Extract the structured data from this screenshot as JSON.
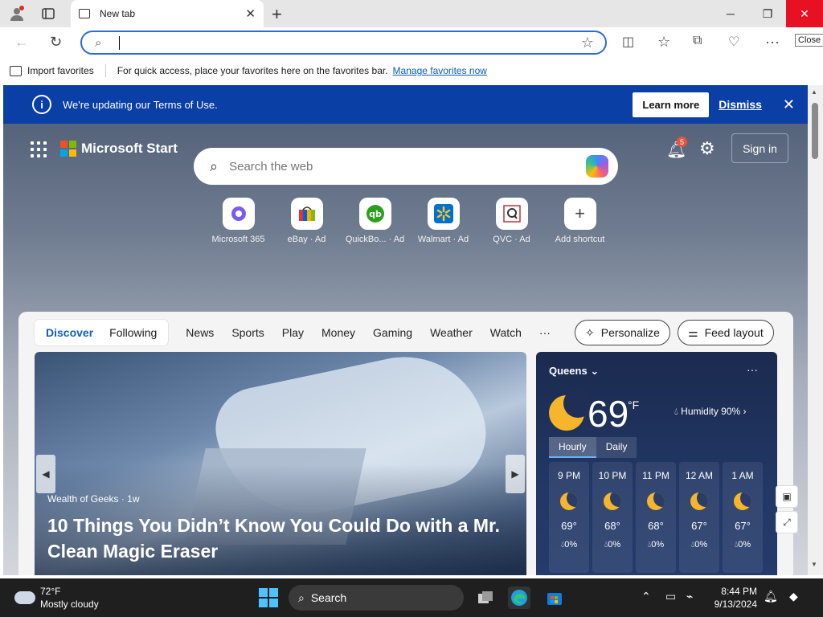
{
  "browser": {
    "tab_title": "New tab",
    "close_tooltip": "Close",
    "address_value": "",
    "favorites_bar": {
      "import_label": "Import favorites",
      "hint": "For quick access, place your favorites here on the favorites bar.",
      "manage_link": "Manage favorites now"
    }
  },
  "banner": {
    "message": "We're updating our Terms of Use.",
    "learn_more": "Learn more",
    "dismiss": "Dismiss"
  },
  "start": {
    "brand": "Microsoft Start",
    "notification_count": "5",
    "sign_in": "Sign in",
    "search_placeholder": "Search the web",
    "shortcuts": [
      {
        "label": "Microsoft 365",
        "icon": "microsoft-365-icon"
      },
      {
        "label": "eBay · Ad",
        "icon": "ebay-icon"
      },
      {
        "label": "QuickBo... · Ad",
        "icon": "quickbooks-icon"
      },
      {
        "label": "Walmart · Ad",
        "icon": "walmart-icon"
      },
      {
        "label": "QVC · Ad",
        "icon": "qvc-icon"
      },
      {
        "label": "Add shortcut",
        "icon": "plus-icon"
      }
    ]
  },
  "feed": {
    "pill_tabs": [
      "Discover",
      "Following"
    ],
    "nav": [
      "News",
      "Sports",
      "Play",
      "Money",
      "Gaming",
      "Weather",
      "Watch"
    ],
    "more": "···",
    "personalize": "Personalize",
    "feed_layout": "Feed layout",
    "hero": {
      "source": "Wealth of Geeks · 1w",
      "headline": "10 Things You Didn’t Know You Could Do with a Mr. Clean Magic Eraser"
    }
  },
  "weather": {
    "location": "Queens",
    "temp": "69",
    "unit": "°F",
    "humidity": "Humidity 90%",
    "tabs": [
      "Hourly",
      "Daily"
    ],
    "hours": [
      {
        "time": "9 PM",
        "temp": "69°",
        "precip": "0%"
      },
      {
        "time": "10 PM",
        "temp": "68°",
        "precip": "0%"
      },
      {
        "time": "11 PM",
        "temp": "68°",
        "precip": "0%"
      },
      {
        "time": "12 AM",
        "temp": "67°",
        "precip": "0%"
      },
      {
        "time": "1 AM",
        "temp": "67°",
        "precip": "0%"
      }
    ]
  },
  "taskbar": {
    "weather_temp": "72°F",
    "weather_desc": "Mostly cloudy",
    "search_label": "Search",
    "time": "8:44 PM",
    "date": "9/13/2024"
  },
  "colors": {
    "banner": "#0a3fa6",
    "accent": "#0f5fbf",
    "close_button": "#e81123"
  }
}
